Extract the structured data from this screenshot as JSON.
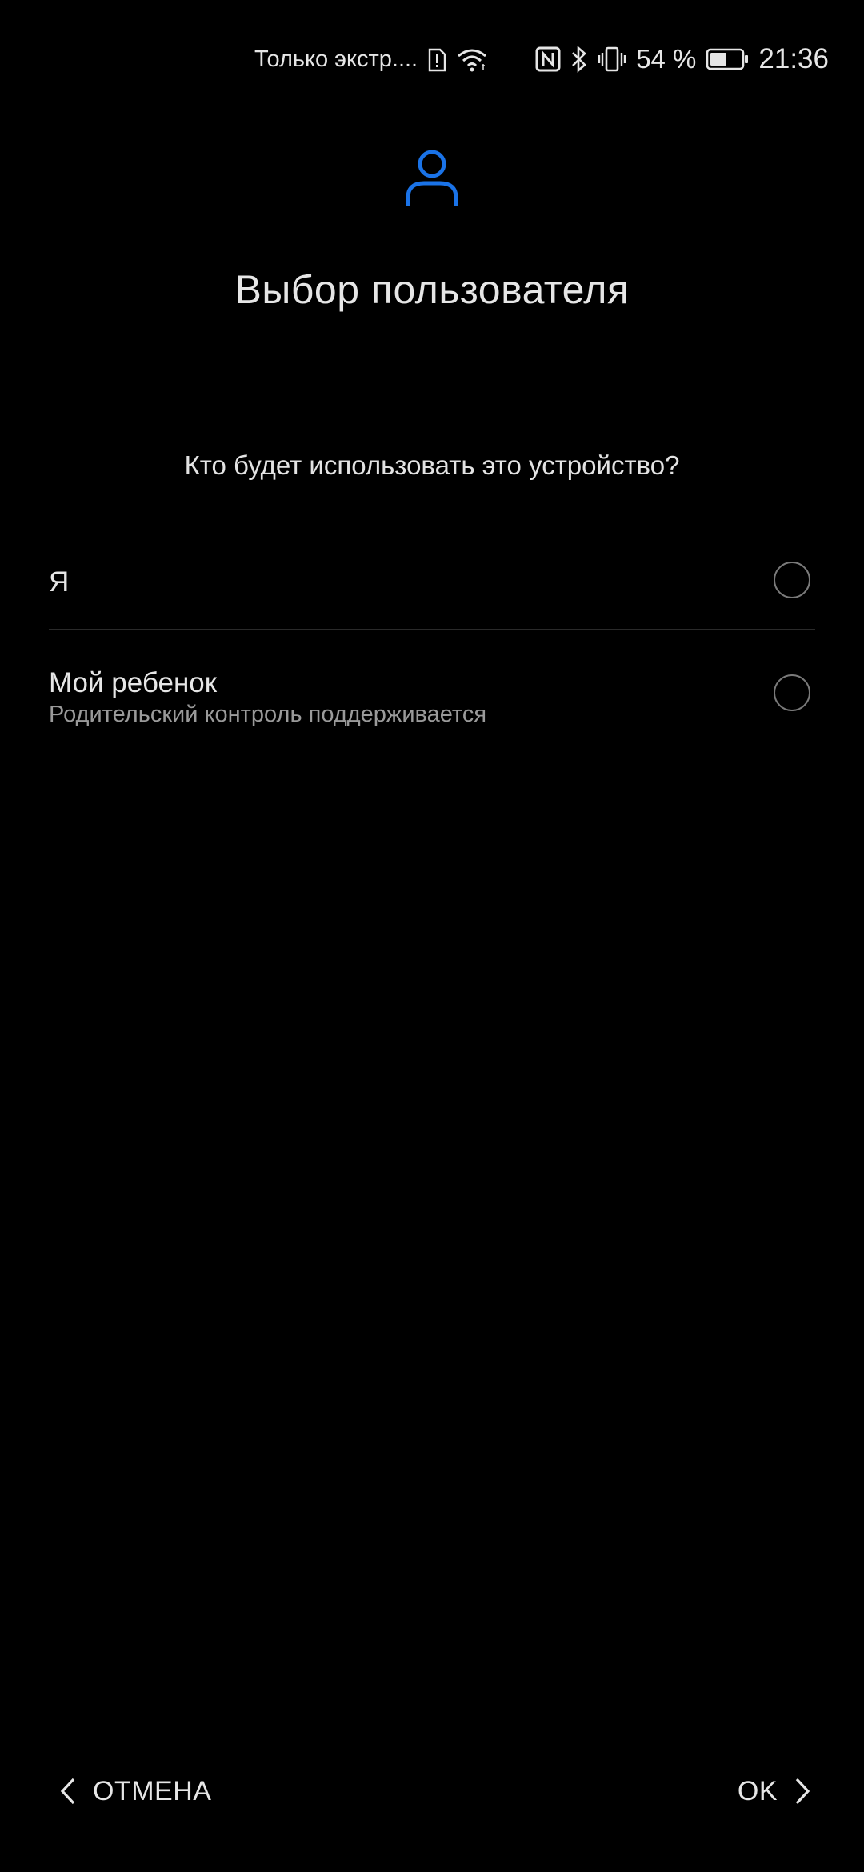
{
  "status_bar": {
    "carrier_text": "Только экстр....",
    "battery_percent": "54 %",
    "time": "21:36",
    "icons": [
      "sim-alert-icon",
      "wifi-icon",
      "nfc-icon",
      "bluetooth-icon",
      "vibrate-icon",
      "battery-icon"
    ],
    "battery_level": 0.54
  },
  "header": {
    "icon": "person-icon",
    "title": "Выбор пользователя",
    "accent_color": "#1a73e8"
  },
  "question": "Кто будет использовать это устройство?",
  "options": [
    {
      "label": "Я",
      "sublabel": "",
      "selected": false
    },
    {
      "label": "Мой ребенок",
      "sublabel": "Родительский контроль поддерживается",
      "selected": false
    }
  ],
  "footer": {
    "cancel_label": "ОТМЕНА",
    "ok_label": "OK"
  }
}
